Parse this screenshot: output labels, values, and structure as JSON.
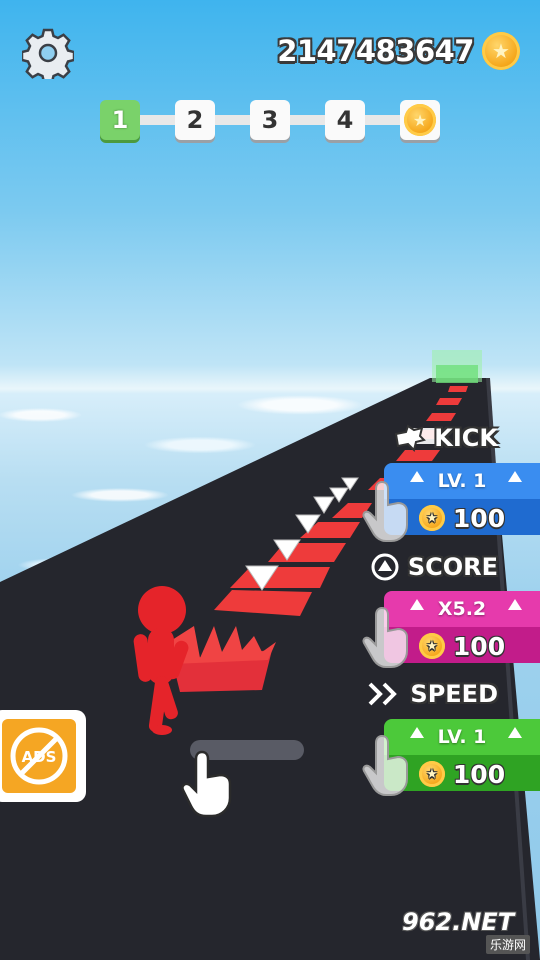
{
  "hud": {
    "coin_balance": "2147483647",
    "settings_icon": "gear-icon",
    "coin_icon": "coin-icon"
  },
  "level_progress": {
    "current_level": 1,
    "levels": [
      "1",
      "2",
      "3",
      "4"
    ],
    "final_reward_icon": "coin-icon"
  },
  "upgrades": [
    {
      "name": "KICK",
      "icon": "kick-icon",
      "value": "LV. 1",
      "cost": "100",
      "color": "#3a8df0"
    },
    {
      "name": "SCORE",
      "icon": "arrow-up-circle-icon",
      "value": "X5.2",
      "cost": "100",
      "color": "#e63aac"
    },
    {
      "name": "SPEED",
      "icon": "double-chevron-right-icon",
      "value": "LV. 1",
      "cost": "100",
      "color": "#4cc93a"
    }
  ],
  "no_ads": {
    "label": "ADS",
    "color": "#f5a623"
  },
  "watermark": {
    "text": "962.NET",
    "sub": "乐游网"
  }
}
